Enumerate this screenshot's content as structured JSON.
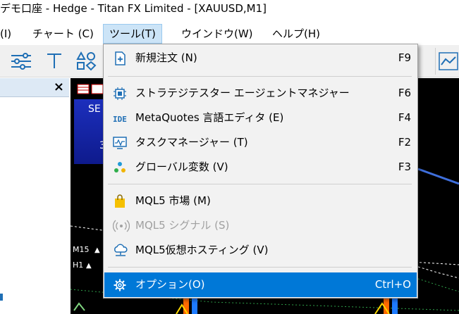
{
  "window": {
    "title": "デモ口座 - Hedge - Titan FX Limited - [XAUUSD,M1]"
  },
  "menubar": {
    "items": [
      {
        "label": "(I)"
      },
      {
        "label": "チャート (C)"
      },
      {
        "label": "ツール(T)"
      },
      {
        "label": "ウインドウ(W)"
      },
      {
        "label": "ヘルプ(H)"
      }
    ]
  },
  "left_panel": {
    "close": "×"
  },
  "chart": {
    "panel_label": "SE",
    "panel_value": "3",
    "timeframes": [
      "M15",
      "H1"
    ]
  },
  "tools_menu": {
    "items": [
      {
        "label": "新規注文 (N)",
        "shortcut": "F9",
        "icon": "new-order-icon"
      },
      {
        "label": "ストラテジテスター エージェントマネジャー",
        "shortcut": "F6",
        "icon": "chip-icon"
      },
      {
        "label": "MetaQuotes 言語エディタ (E)",
        "shortcut": "F4",
        "icon": "ide-icon"
      },
      {
        "label": "タスクマネージャー (T)",
        "shortcut": "F2",
        "icon": "monitor-icon"
      },
      {
        "label": "グローバル変数 (V)",
        "shortcut": "F3",
        "icon": "dots-icon"
      },
      {
        "label": "MQL5 市場 (M)",
        "shortcut": "",
        "icon": "shopping-bag-icon"
      },
      {
        "label": "MQL5 シグナル (S)",
        "shortcut": "",
        "icon": "signal-icon"
      },
      {
        "label": "MQL5仮想ホスティング (V)",
        "shortcut": "",
        "icon": "cloud-icon"
      },
      {
        "label": "オプション(O)",
        "shortcut": "Ctrl+O",
        "icon": "gear-icon"
      }
    ]
  },
  "colors": {
    "accent": "#0078d7",
    "menu_active": "#cce4f7",
    "chart_bg": "#000000"
  }
}
